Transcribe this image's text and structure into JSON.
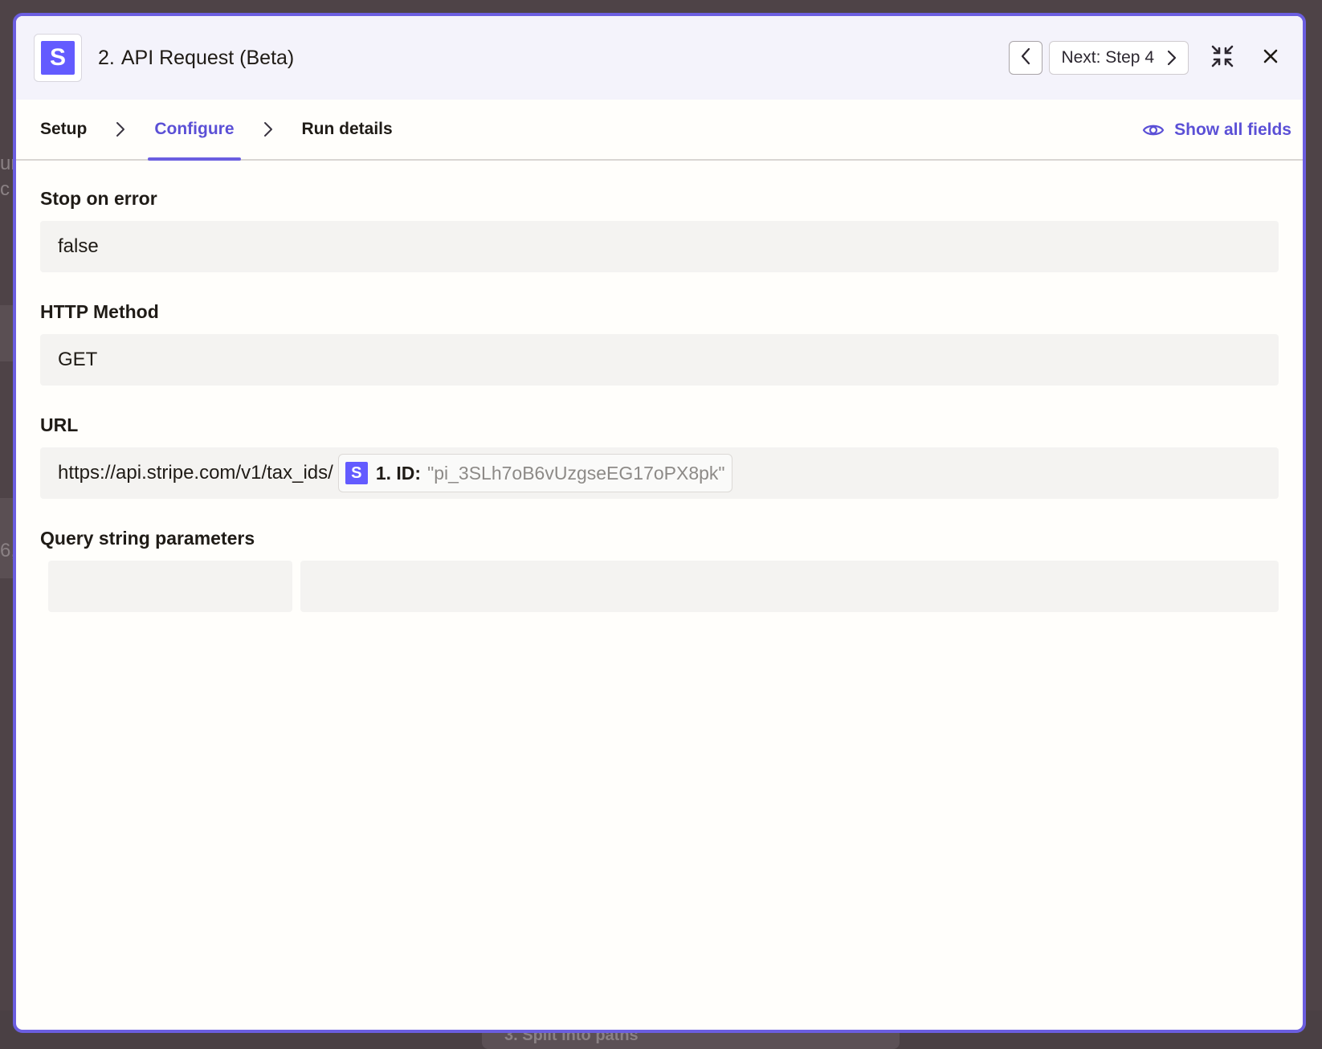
{
  "background": {
    "fragments": [
      "ur",
      "c",
      "6,",
      "3. Split into paths"
    ]
  },
  "header": {
    "app_logo_letter": "S",
    "step_number": "2.",
    "title": "API Request (Beta)",
    "next_label": "Next: Step 4",
    "prev_icon": "chevron-left-icon",
    "collapse_icon": "collapse-icon",
    "close_icon": "close-icon"
  },
  "tabs": {
    "items": [
      {
        "label": "Setup",
        "active": false
      },
      {
        "label": "Configure",
        "active": true
      },
      {
        "label": "Run details",
        "active": false
      }
    ],
    "show_all_label": "Show all fields"
  },
  "fields": {
    "stop_on_error": {
      "label": "Stop on error",
      "value": "false"
    },
    "http_method": {
      "label": "HTTP Method",
      "value": "GET"
    },
    "url": {
      "label": "URL",
      "value": "https://api.stripe.com/v1/tax_ids/",
      "token": {
        "icon_letter": "S",
        "label": "1. ID:",
        "value": "\"pi_3SLh7oB6vUzgseEG17oPX8pk\""
      }
    },
    "query_string": {
      "label": "Query string parameters",
      "key": "",
      "value": ""
    }
  },
  "colors": {
    "accent": "#6b5ee0",
    "stripe": "#635bff",
    "header_bg": "#f4f3fb",
    "field_bg": "#f4f3f1"
  }
}
